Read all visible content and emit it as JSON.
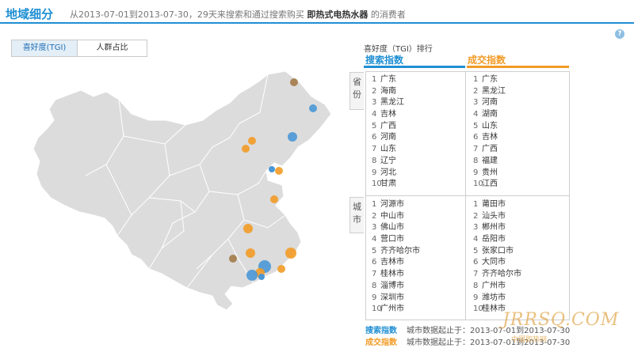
{
  "header": {
    "title": "地域细分",
    "subtitle_prefix": "从2013-07-01到2013-07-30，29天来搜索和通过搜索购买",
    "product": "即热式电热水器",
    "subtitle_suffix": "的消费者",
    "help_icon": "?"
  },
  "tabs": [
    {
      "label": "喜好度(TGI)",
      "active": true
    },
    {
      "label": "人群占比",
      "active": false
    }
  ],
  "ranking": {
    "title": "喜好度（TGI）排行",
    "search_header": "搜索指数",
    "deal_header": "成交指数",
    "province_label": "省份",
    "city_label": "城市",
    "provinces_search": [
      {
        "n": "1",
        "name": "广东"
      },
      {
        "n": "2",
        "name": "海南"
      },
      {
        "n": "3",
        "name": "黑龙江"
      },
      {
        "n": "4",
        "name": "吉林"
      },
      {
        "n": "5",
        "name": "广西"
      },
      {
        "n": "6",
        "name": "河南"
      },
      {
        "n": "7",
        "name": "山东"
      },
      {
        "n": "8",
        "name": "辽宁"
      },
      {
        "n": "9",
        "name": "河北"
      },
      {
        "n": "10",
        "name": "甘肃"
      }
    ],
    "provinces_deal": [
      {
        "n": "1",
        "name": "广东"
      },
      {
        "n": "2",
        "name": "黑龙江"
      },
      {
        "n": "3",
        "name": "河南"
      },
      {
        "n": "4",
        "name": "湖南"
      },
      {
        "n": "5",
        "name": "山东"
      },
      {
        "n": "6",
        "name": "吉林"
      },
      {
        "n": "7",
        "name": "广西"
      },
      {
        "n": "8",
        "name": "福建"
      },
      {
        "n": "9",
        "name": "贵州"
      },
      {
        "n": "10",
        "name": "江西"
      }
    ],
    "cities_search": [
      {
        "n": "1",
        "name": "河源市"
      },
      {
        "n": "2",
        "name": "中山市"
      },
      {
        "n": "3",
        "name": "佛山市"
      },
      {
        "n": "4",
        "name": "营口市"
      },
      {
        "n": "5",
        "name": "齐齐哈尔市"
      },
      {
        "n": "6",
        "name": "吉林市"
      },
      {
        "n": "7",
        "name": "桂林市"
      },
      {
        "n": "8",
        "name": "淄博市"
      },
      {
        "n": "9",
        "name": "深圳市"
      },
      {
        "n": "10",
        "name": "广州市"
      }
    ],
    "cities_deal": [
      {
        "n": "1",
        "name": "莆田市"
      },
      {
        "n": "2",
        "name": "汕头市"
      },
      {
        "n": "3",
        "name": "郴州市"
      },
      {
        "n": "4",
        "name": "岳阳市"
      },
      {
        "n": "5",
        "name": "张家口市"
      },
      {
        "n": "6",
        "name": "大同市"
      },
      {
        "n": "7",
        "name": "齐齐哈尔市"
      },
      {
        "n": "8",
        "name": "广州市"
      },
      {
        "n": "9",
        "name": "潍坊市"
      },
      {
        "n": "10",
        "name": "桂林市"
      }
    ]
  },
  "footer": {
    "search_label": "搜索指数",
    "search_text": "城市数据起止于：2013-07-01到2013-07-30",
    "deal_label": "成交指数",
    "deal_text": "城市数据起止于：2013-07-01到2013-07-30"
  },
  "watermark": {
    "main": "JRRSQ.COM",
    "sub": "中国即热网"
  },
  "colors": {
    "accent": "#1f8fd3",
    "search": "#4a97d6",
    "deal": "#f29b26",
    "map_fill": "#dcdcdc"
  }
}
